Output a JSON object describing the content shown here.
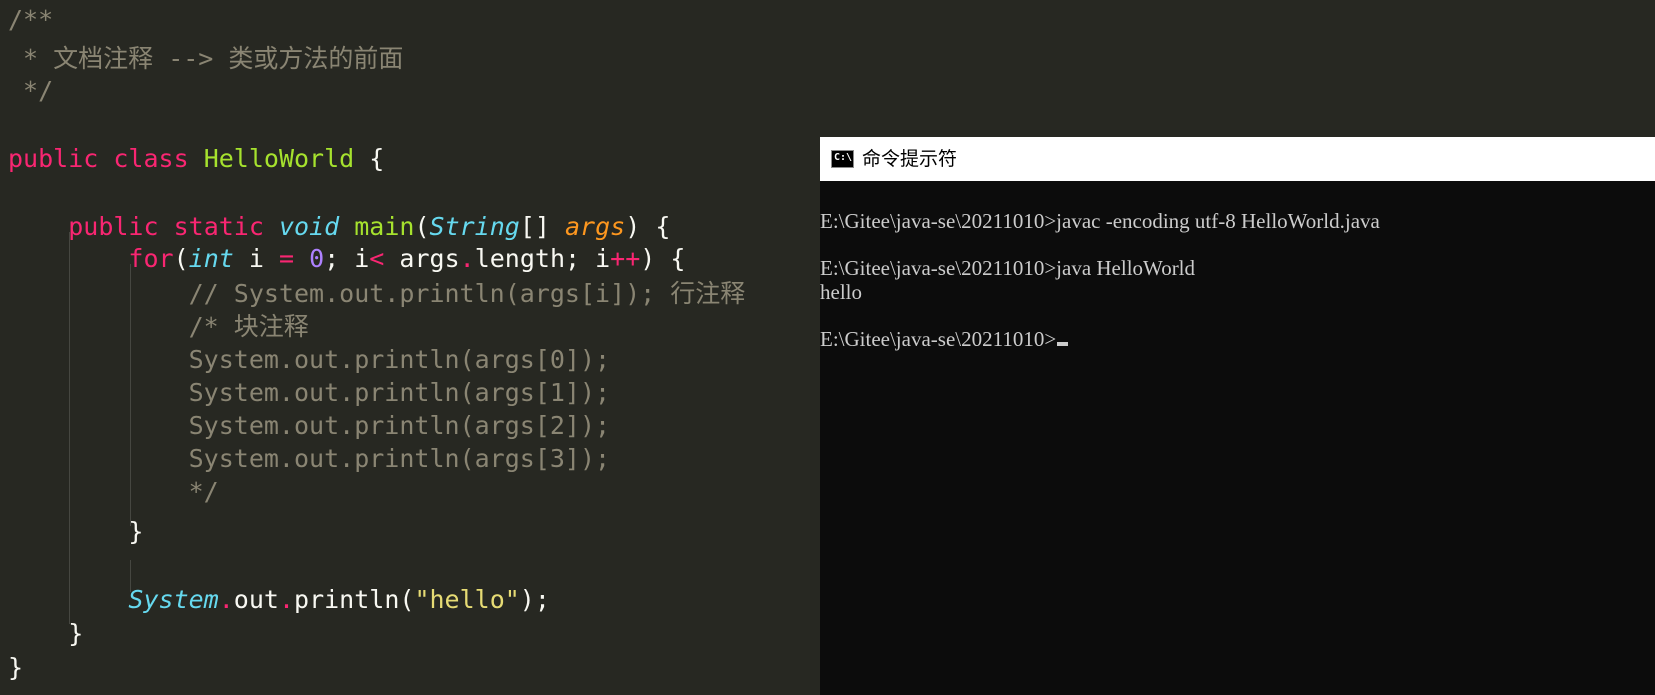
{
  "editor": {
    "lines": {
      "l1": "/**",
      "l2": " * 文档注释 --> 类或方法的前面",
      "l3": " */",
      "class_kw1": "public",
      "class_kw2": "class",
      "class_name": "HelloWorld",
      "class_open": "{",
      "main_kw1": "public",
      "main_kw2": "static",
      "main_void": "void",
      "main_name": "main",
      "main_p1": "(",
      "main_type": "String",
      "main_p2": "[] ",
      "main_args": "args",
      "main_p3": ") {",
      "for_kw": "for",
      "for_p1": "(",
      "for_int": "int",
      "for_p2": " i ",
      "for_eq": "=",
      "for_p3": " ",
      "for_zero": "0",
      "for_p4": "; i",
      "for_lt": "<",
      "for_p5": " args",
      "for_dot": ".",
      "for_p6": "length; i",
      "for_pp": "++",
      "for_p7": ") {",
      "c1": "// System.out.println(args[i]); 行注释",
      "c2": "/* 块注释",
      "c3": "System.out.println(args[0]);",
      "c4": "System.out.println(args[1]);",
      "c5": "System.out.println(args[2]);",
      "c6": "System.out.println(args[3]);",
      "c7": "*/",
      "for_close": "}",
      "sys_type": "System",
      "sys_dot1": ".",
      "sys_out": "out",
      "sys_dot2": ".",
      "sys_print": "println(",
      "sys_str": "\"hello\"",
      "sys_end": ");",
      "main_close": "}",
      "class_close": "}"
    }
  },
  "terminal": {
    "title": "命令提示符",
    "icon": "cmd-icon",
    "icon_text": "C:\\.",
    "lines": [
      "E:\\Gitee\\java-se\\20211010>javac -encoding utf-8 HelloWorld.java",
      "E:\\Gitee\\java-se\\20211010>java HelloWorld",
      "hello",
      "E:\\Gitee\\java-se\\20211010>"
    ]
  },
  "colors": {
    "editor_bg": "#272822",
    "comment": "#8a8573",
    "keyword": "#f92672",
    "type": "#66d9ef",
    "function": "#a6e22e",
    "param": "#fd971f",
    "number": "#ae81ff",
    "string": "#e6db74",
    "terminal_bg": "#0c0c0c",
    "terminal_text": "#cccccc"
  }
}
